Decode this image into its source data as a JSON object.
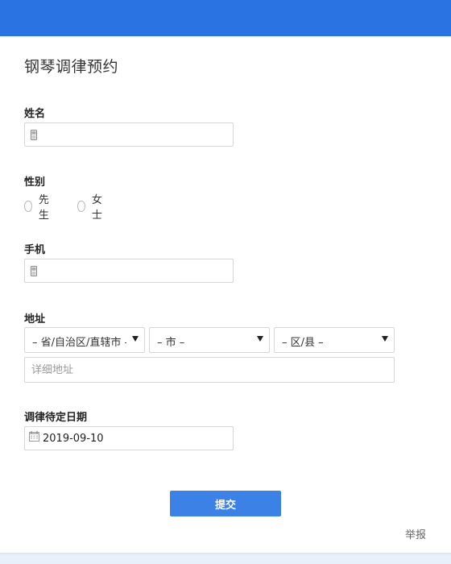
{
  "header": {
    "color": "#2a73e3"
  },
  "form": {
    "title": "钢琴调律预约",
    "name": {
      "label": "姓名",
      "value": ""
    },
    "gender": {
      "label": "性别",
      "options": [
        "先生",
        "女士"
      ]
    },
    "phone": {
      "label": "手机",
      "value": ""
    },
    "address": {
      "label": "地址",
      "province": "– 省/自治区/直辖市 –",
      "city": "– 市 –",
      "district": "– 区/县 –",
      "detail_placeholder": "详细地址"
    },
    "date": {
      "label": "调律待定日期",
      "value": "2019-09-10"
    },
    "submit_label": "提交",
    "report_label": "举报"
  },
  "icons": {
    "name_field": "phone-icon",
    "phone_field": "phone-icon",
    "date_field": "calendar-icon",
    "select_arrow": "dropdown-arrow-icon"
  }
}
